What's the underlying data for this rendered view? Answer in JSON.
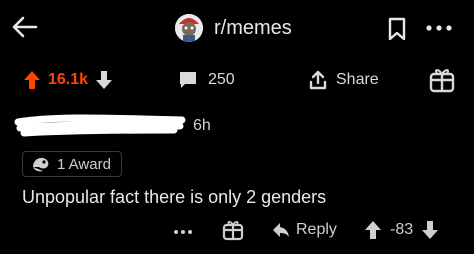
{
  "header": {
    "subreddit": "r/memes"
  },
  "post_actions": {
    "score": "16.1k",
    "comments": "250",
    "share_label": "Share"
  },
  "comment": {
    "time": "6h",
    "award_label": "1 Award",
    "body": "Unpopular fact there is only 2 genders",
    "reply_label": "Reply",
    "score": "-83"
  },
  "colors": {
    "upvote": "#ff4500",
    "background": "#000000",
    "text": "#d7dadc"
  }
}
